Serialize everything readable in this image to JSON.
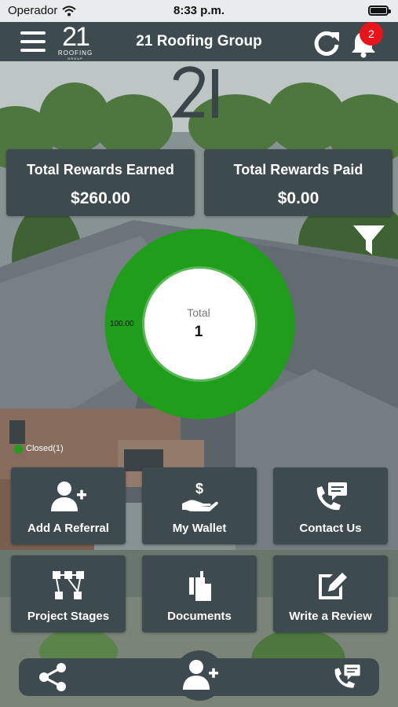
{
  "status_bar": {
    "carrier": "Operador",
    "time": "8:33 p.m."
  },
  "header": {
    "title": "21 Roofing Group",
    "logo_number": "21",
    "logo_word": "ROOFING",
    "logo_sub": "GROUP",
    "notification_count": "2"
  },
  "rewards": {
    "earned_label": "Total Rewards Earned",
    "earned_value": "$260.00",
    "paid_label": "Total Rewards Paid",
    "paid_value": "$0.00"
  },
  "chart_data": {
    "type": "pie",
    "categories": [
      "Closed"
    ],
    "values": [
      1
    ],
    "percent_label": "100.00",
    "center_label": "Total",
    "center_value": "1",
    "legend": [
      "Closed(1)"
    ],
    "colors": [
      "#1f9d1b"
    ]
  },
  "tiles": [
    {
      "label": "Add A Referral",
      "icon": "add-user-icon"
    },
    {
      "label": "My Wallet",
      "icon": "wallet-icon"
    },
    {
      "label": "Contact Us",
      "icon": "contact-phone-icon"
    },
    {
      "label": "Project Stages",
      "icon": "project-stages-icon"
    },
    {
      "label": "Documents",
      "icon": "documents-icon"
    },
    {
      "label": "Write a Review",
      "icon": "write-review-icon"
    }
  ],
  "bottom_bar": {
    "icons": [
      "share-icon",
      "add-user-icon",
      "contact-phone-icon"
    ]
  },
  "colors": {
    "panel": "#3d4a50",
    "accent_green": "#1f9d1b",
    "badge_red": "#e8141c"
  }
}
